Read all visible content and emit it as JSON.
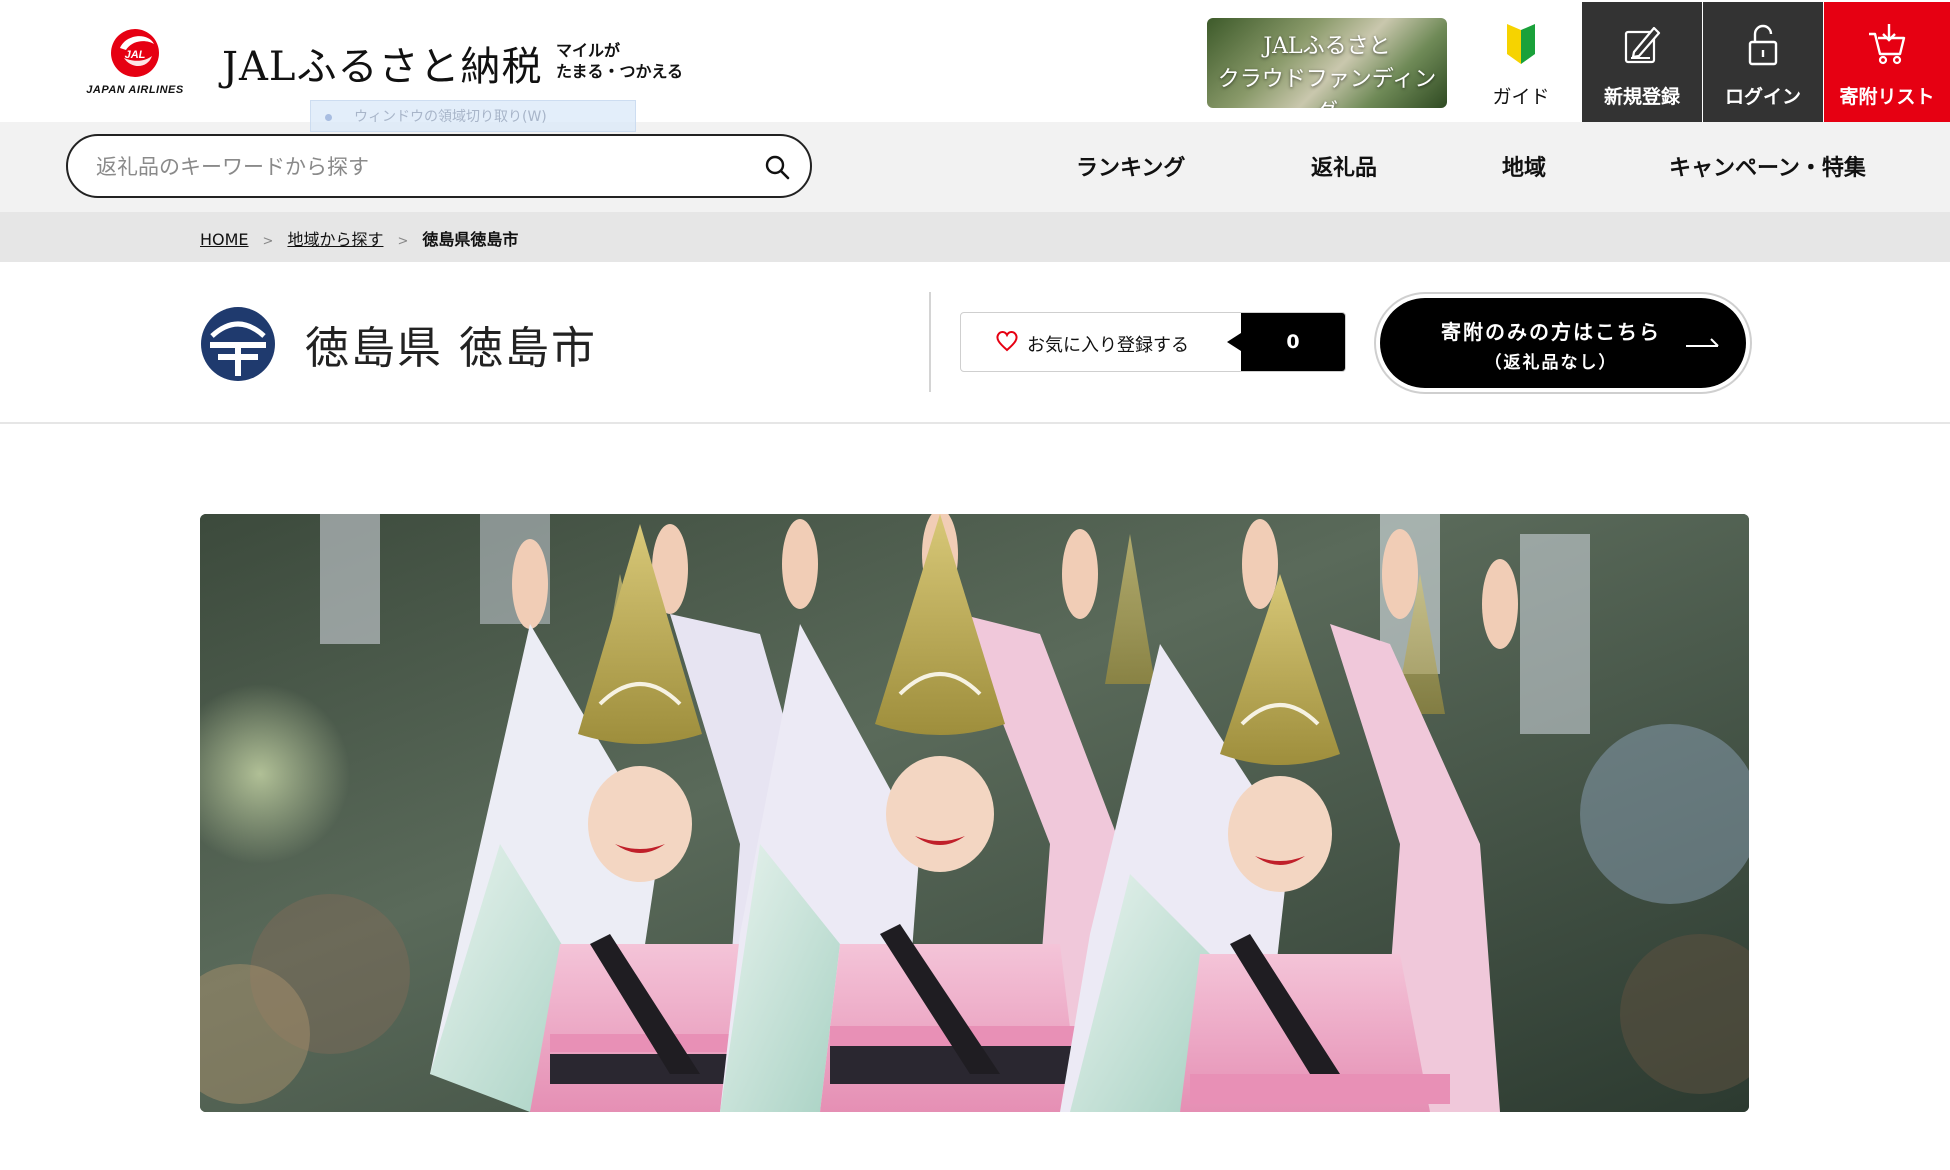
{
  "header": {
    "logo_text": "JAPAN AIRLINES",
    "site_title": "JALふるさと納税",
    "tagline_line1": "マイルが",
    "tagline_line2": "たまる・つかえる",
    "crowdfunding_line1": "JALふるさと",
    "crowdfunding_line2": "クラウドファンディング",
    "buttons": {
      "guide": "ガイド",
      "register": "新規登録",
      "login": "ログイン",
      "donation_list": "寄附リスト"
    },
    "overlay_text": "ウィンドウの領域切り取り(W)"
  },
  "nav": {
    "search_placeholder": "返礼品のキーワードから探す",
    "items": [
      "ランキング",
      "返礼品",
      "地域",
      "キャンペーン・特集"
    ]
  },
  "breadcrumb": {
    "home": "HOME",
    "region": "地域から探す",
    "current": "徳島県徳島市"
  },
  "municipality": {
    "name": "徳島県 徳島市",
    "favorite_label": "お気に入り登録する",
    "favorite_count": "0",
    "donate_only_line1": "寄附のみの方はこちら",
    "donate_only_line2": "（返礼品なし）"
  },
  "colors": {
    "jal_red": "#e60012",
    "dark_button": "#333333",
    "navbar_bg": "#f2f2f2",
    "breadcrumb_bg": "#e6e6e6",
    "emblem_navy": "#1f3a6e"
  },
  "icons": {
    "guide": "beginner-mark-icon",
    "register": "edit-form-icon",
    "login": "padlock-icon",
    "donation_list": "cart-icon",
    "search": "search-icon",
    "favorite": "heart-icon",
    "donate_only": "arrow-right-icon"
  }
}
